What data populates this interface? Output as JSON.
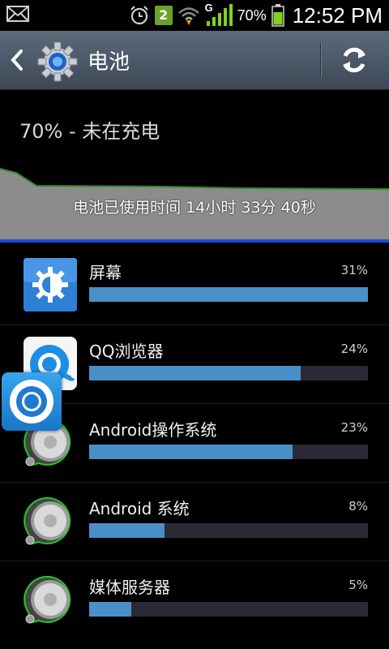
{
  "status_bar": {
    "badge": "2",
    "network": "G",
    "battery_percent": "70%",
    "time": "12:52 PM"
  },
  "header": {
    "title": "电池"
  },
  "summary": {
    "status_text": "70% - 未在充电",
    "usage_time": "电池已使用时间 14小时 33分 40秒"
  },
  "items": [
    {
      "name": "屏幕",
      "percent": "31%",
      "fraction": 1.0,
      "icon": "screen-brightness-icon"
    },
    {
      "name": "QQ浏览器",
      "percent": "24%",
      "fraction": 0.76,
      "icon": "qq-browser-icon"
    },
    {
      "name": "Android操作系统",
      "percent": "23%",
      "fraction": 0.73,
      "icon": "android-os-icon"
    },
    {
      "name": "Android 系统",
      "percent": "8%",
      "fraction": 0.27,
      "icon": "android-system-icon"
    },
    {
      "name": "媒体服务器",
      "percent": "5%",
      "fraction": 0.15,
      "icon": "media-server-icon"
    }
  ],
  "colors": {
    "bar": "#4a90c8",
    "action_bar": "#4a5666",
    "graph_line": "#2e8b2e"
  }
}
